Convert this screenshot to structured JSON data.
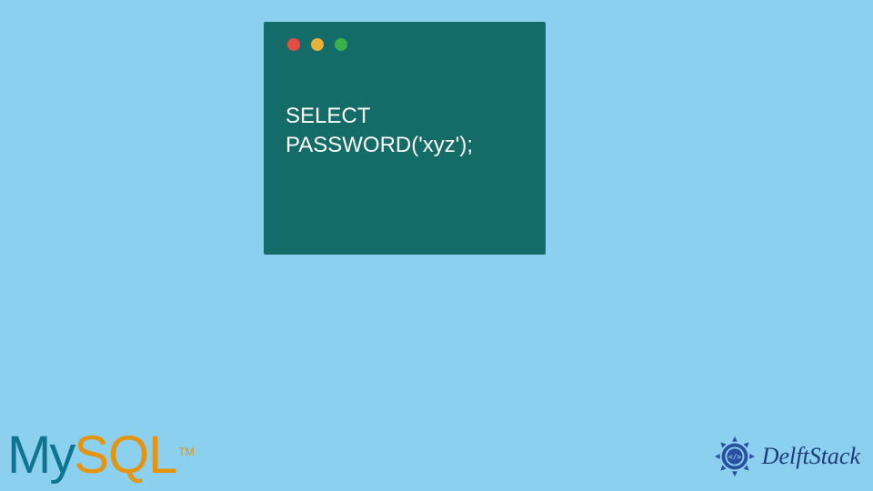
{
  "code_window": {
    "line1": "SELECT",
    "line2": "PASSWORD('xyz');"
  },
  "logos": {
    "mysql_my": "My",
    "mysql_sql": "SQL",
    "mysql_tm": "TM",
    "delft_text": "DelftStack"
  }
}
